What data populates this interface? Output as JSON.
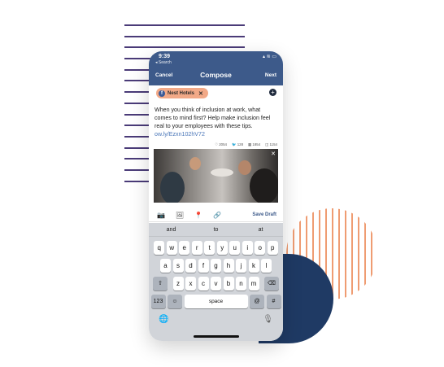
{
  "status_bar": {
    "time": "9:39",
    "back_label": "◂ Search",
    "icons": "▴ ≋ ▭"
  },
  "nav": {
    "cancel": "Cancel",
    "title": "Compose",
    "next": "Next"
  },
  "account_chip": {
    "label": "Nest Hotels",
    "remove": "✕",
    "network_icon": "f"
  },
  "add_account": "+",
  "post": {
    "text": "When you think of inclusion at work, what comes to mind first? Help make inclusion feel real to your employees with these tips. ",
    "link": "ow.ly/Ezxn102hV72"
  },
  "counts": {
    "facebook": "2054",
    "twitter": "128",
    "linkedin": "1854",
    "instagram": "1154"
  },
  "toolbar": {
    "camera": "📷",
    "image": "🖼",
    "location": "📍",
    "link": "🔗",
    "save_draft": "Save Draft"
  },
  "keyboard": {
    "suggestions": [
      "and",
      "to",
      "at"
    ],
    "row1": [
      "q",
      "w",
      "e",
      "r",
      "t",
      "y",
      "u",
      "i",
      "o",
      "p"
    ],
    "row2": [
      "a",
      "s",
      "d",
      "f",
      "g",
      "h",
      "j",
      "k",
      "l"
    ],
    "row3": [
      "z",
      "x",
      "c",
      "v",
      "b",
      "n",
      "m"
    ],
    "shift": "⇧",
    "delete": "⌫",
    "numbers": "123",
    "emoji": "☺",
    "space": "space",
    "at": "@",
    "hash": "#",
    "globe": "🌐",
    "mic": "🎙"
  },
  "colors": {
    "header": "#3d5a8a",
    "chip": "#f2a987",
    "link": "#4a76b8"
  }
}
